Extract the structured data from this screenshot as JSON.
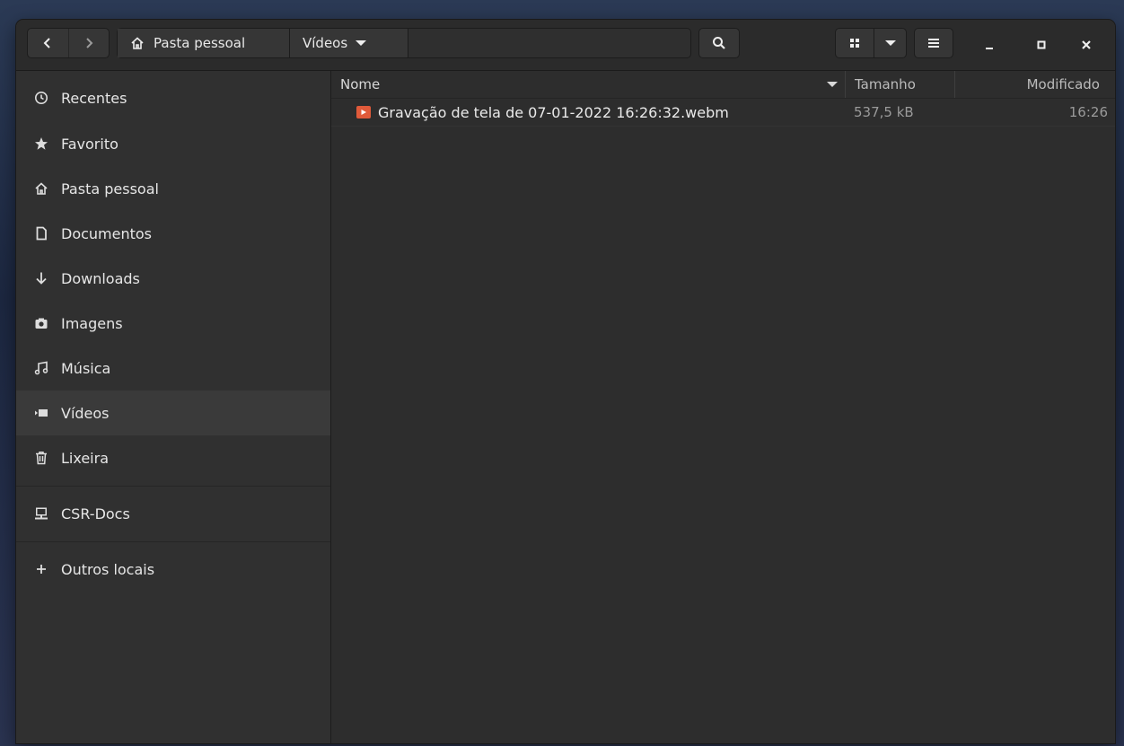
{
  "header": {
    "breadcrumb_home": "Pasta pessoal",
    "breadcrumb_current": "Vídeos"
  },
  "sidebar": {
    "items": [
      {
        "label": "Recentes",
        "icon": "clock-icon"
      },
      {
        "label": "Favorito",
        "icon": "star-icon"
      },
      {
        "label": "Pasta pessoal",
        "icon": "home-icon"
      },
      {
        "label": "Documentos",
        "icon": "document-icon"
      },
      {
        "label": "Downloads",
        "icon": "download-icon"
      },
      {
        "label": "Imagens",
        "icon": "camera-icon"
      },
      {
        "label": "Música",
        "icon": "music-icon"
      },
      {
        "label": "Vídeos",
        "icon": "video-icon",
        "active": true
      },
      {
        "label": "Lixeira",
        "icon": "trash-icon"
      },
      {
        "label": "CSR-Docs",
        "icon": "network-drive-icon"
      },
      {
        "label": "Outros locais",
        "icon": "plus-icon"
      }
    ]
  },
  "list": {
    "columns": {
      "name": "Nome",
      "size": "Tamanho",
      "modified": "Modificado"
    },
    "files": [
      {
        "name": "Gravação de tela de 07-01-2022 16:26:32.webm",
        "size": "537,5 kB",
        "modified": "16:26",
        "icon": "video-file-icon"
      }
    ]
  },
  "colors": {
    "window_bg": "#2d2d2d",
    "sidebar_bg": "#303030",
    "active_item_bg": "#3a3a3a",
    "video_icon": "#e05a3a"
  }
}
